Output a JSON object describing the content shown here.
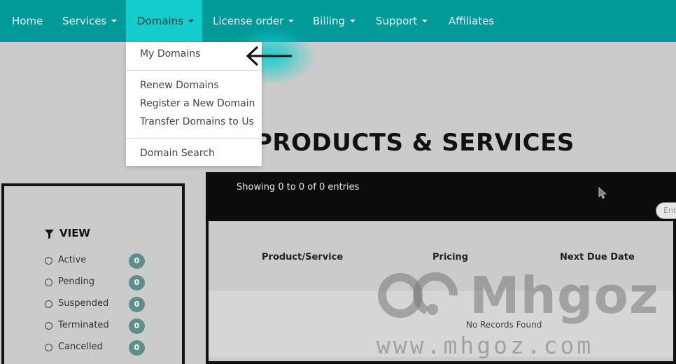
{
  "nav": {
    "items": [
      {
        "label": "Home",
        "has_caret": false
      },
      {
        "label": "Services",
        "has_caret": true
      },
      {
        "label": "Domains",
        "has_caret": true,
        "active": true
      },
      {
        "label": "License order",
        "has_caret": true
      },
      {
        "label": "Billing",
        "has_caret": true
      },
      {
        "label": "Support",
        "has_caret": true
      },
      {
        "label": "Affiliates",
        "has_caret": false
      }
    ]
  },
  "domains_menu": {
    "items": [
      "My Domains",
      "Renew Domains",
      "Register a New Domain",
      "Transfer Domains to Us",
      "Domain Search"
    ]
  },
  "page_title": "PRODUCTS & SERVICES",
  "sidebar": {
    "heading": "VIEW",
    "statuses": [
      {
        "label": "Active",
        "count": "0"
      },
      {
        "label": "Pending",
        "count": "0"
      },
      {
        "label": "Suspended",
        "count": "0"
      },
      {
        "label": "Terminated",
        "count": "0"
      },
      {
        "label": "Cancelled",
        "count": "0"
      }
    ]
  },
  "table": {
    "info": "Showing 0 to 0 of 0 entries",
    "search_placeholder": "Ent",
    "columns": [
      "Product/Service",
      "Pricing",
      "Next Due Date"
    ],
    "empty_text": "No Records Found"
  },
  "watermark": {
    "brand": "Mhgoz",
    "url": "www.mhgoz.com"
  },
  "colors": {
    "nav_bg": "#009a99",
    "nav_active": "#14cccb",
    "badge": "#5e8e8c"
  }
}
